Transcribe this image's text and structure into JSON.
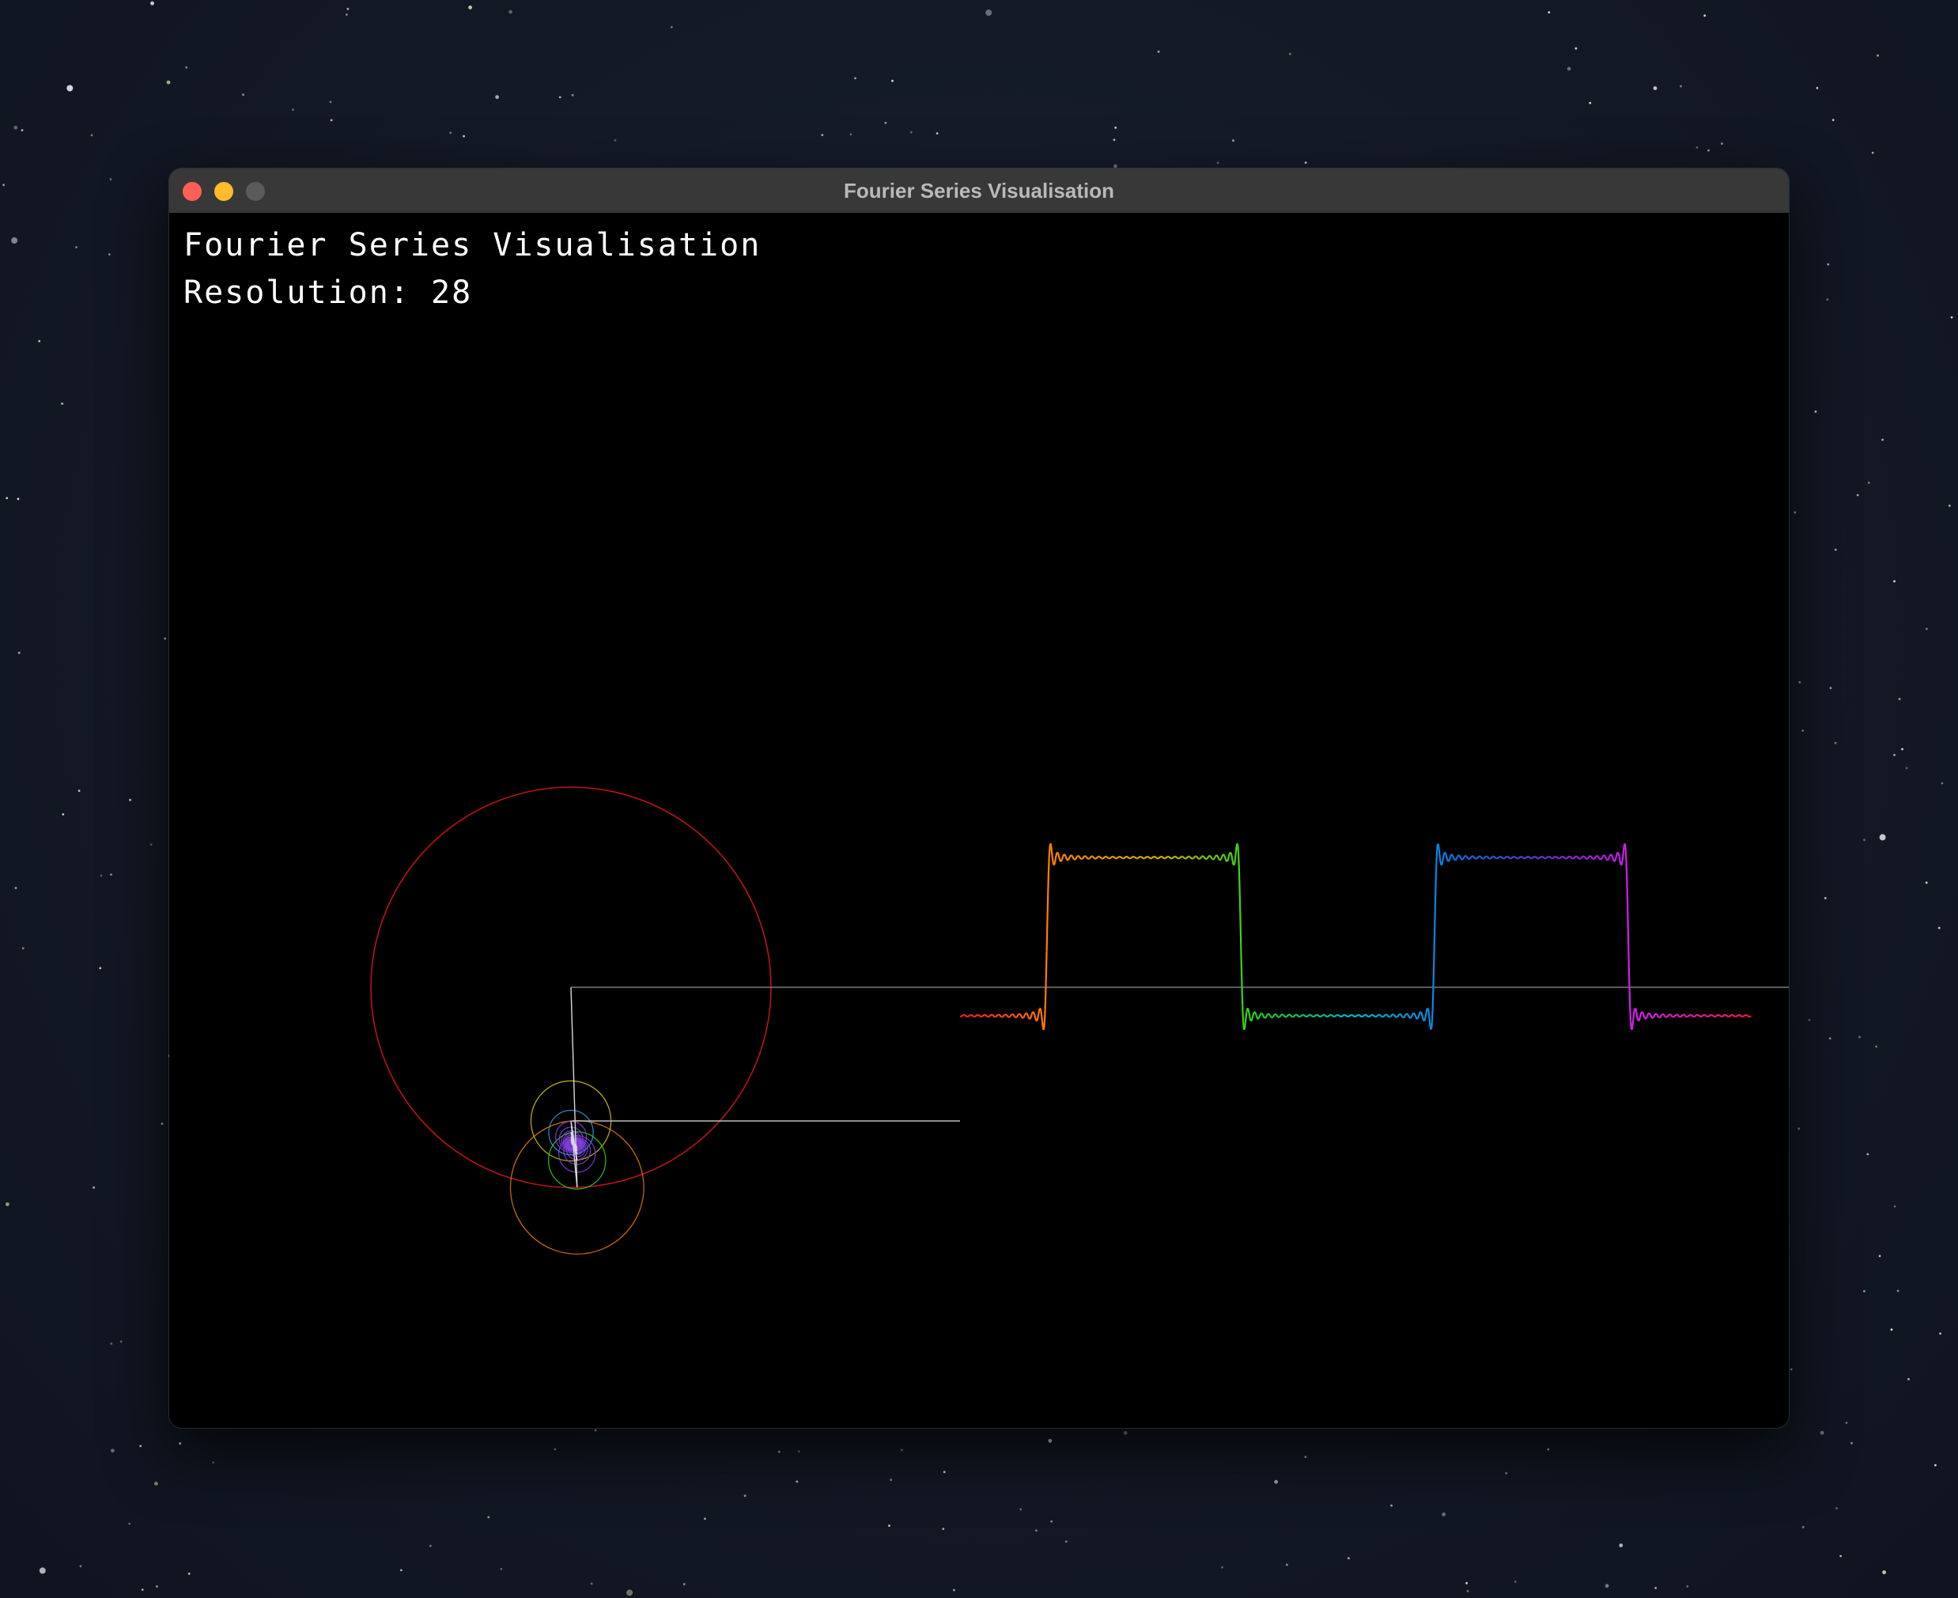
{
  "window": {
    "title": "Fourier Series Visualisation"
  },
  "hud": {
    "title": "Fourier Series Visualisation",
    "resolution_label": "Resolution:",
    "resolution_value": "28"
  },
  "visualisation": {
    "harmonics": 28,
    "waveform": "square",
    "trace_colors": [
      "#ff2020",
      "#ff8a00",
      "#e6c000",
      "#22d41e",
      "#00c8d2",
      "#0a78e6",
      "#7a2ee6",
      "#e61ee6",
      "#ff1e4a"
    ],
    "epicycle_colors": [
      "#c81414",
      "#e07a10",
      "#d6c21a",
      "#30d030",
      "#30a0e0",
      "#8040e0"
    ],
    "pointer_line_color": "#bdbdbd"
  }
}
